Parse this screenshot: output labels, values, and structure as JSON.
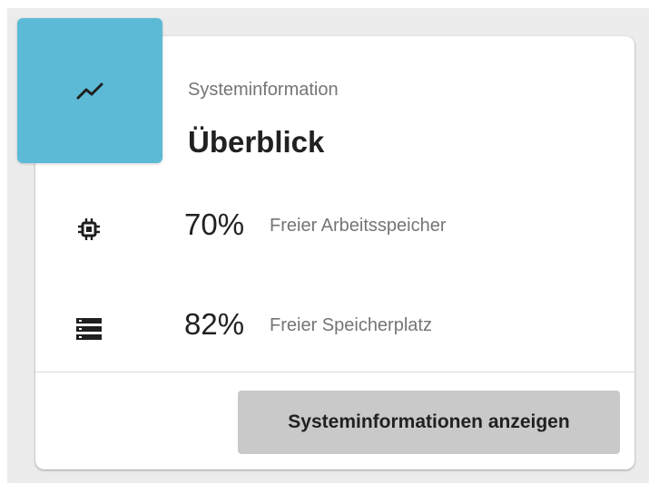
{
  "header": {
    "subtitle": "Systeminformation",
    "title": "Überblick",
    "icon": "trending-up-icon",
    "accent_color": "#5cbad6"
  },
  "stats": [
    {
      "icon": "chip-icon",
      "value": "70%",
      "label": "Freier Arbeitsspeicher"
    },
    {
      "icon": "storage-icon",
      "value": "82%",
      "label": "Freier Speicherplatz"
    }
  ],
  "actions": {
    "primary_label": "Systeminformationen anzeigen"
  }
}
